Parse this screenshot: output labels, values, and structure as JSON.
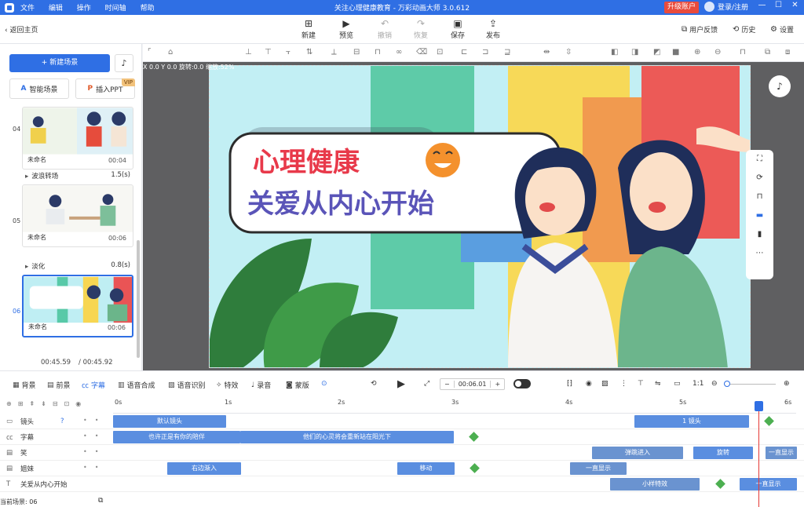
{
  "titlebar": {
    "menu": [
      "文件",
      "编辑",
      "操作",
      "时间轴",
      "帮助"
    ],
    "title": "关注心理健康教育 - 万彩动画大师 3.0.612",
    "upgrade": "升级账户",
    "login": "登录/注册"
  },
  "toolbar": {
    "back": "返回主页",
    "buttons": [
      {
        "label": "新建",
        "icon": "plus-square-icon"
      },
      {
        "label": "预览",
        "icon": "play-icon"
      },
      {
        "label": "撤销",
        "icon": "undo-icon"
      },
      {
        "label": "恢复",
        "icon": "redo-icon"
      },
      {
        "label": "保存",
        "icon": "save-icon"
      },
      {
        "label": "发布",
        "icon": "publish-icon"
      }
    ],
    "right": [
      "用户反馈",
      "历史",
      "设置"
    ]
  },
  "left_panel": {
    "new_scene": "+ 新建场景",
    "smart_scene": "智能场景",
    "insert_ppt": "插入PPT",
    "vip": "VIP",
    "scenes": [
      {
        "num": "04",
        "name": "未命名",
        "duration": "00:04"
      },
      {
        "num": "05",
        "name": "未命名",
        "duration": "00:06"
      },
      {
        "num": "06",
        "name": "未命名",
        "duration": "00:06"
      }
    ],
    "transitions": [
      {
        "name": "波浪转场",
        "duration": "1.5(s)"
      },
      {
        "name": "淡化",
        "duration": "0.8(s)"
      }
    ],
    "current_time": "00:45.59",
    "total_time": "/ 00:45.92"
  },
  "canvas": {
    "coords": "X 0.0  Y 0.0  旋转:0.0  缩放:52%",
    "headline1": "心理健康",
    "headline2": "关爱从内心开始"
  },
  "mainbar": {
    "items": [
      "背景",
      "前景",
      "字幕",
      "语音合成",
      "语音识别",
      "特效",
      "录音",
      "蒙版"
    ],
    "timecode": "00:06.01"
  },
  "timeline": {
    "ruler": [
      "0s",
      "1s",
      "2s",
      "3s",
      "4s",
      "5s",
      "6s"
    ],
    "rows": [
      {
        "label": "镜头",
        "clips": [
          "默认镜头",
          "1 镜头"
        ]
      },
      {
        "label": "字幕",
        "clips": [
          "也许正是有你的陪伴",
          "他们的心灵将会重新站在阳光下"
        ]
      },
      {
        "label": "笑",
        "clips": [
          "弹跳进入",
          "旋转",
          "一直显示"
        ]
      },
      {
        "label": "姐妹",
        "clips": [
          "右边渐入",
          "移动",
          "一直显示"
        ]
      },
      {
        "label": "关爱从内心开始",
        "clips": [
          "小样特效",
          "一直显示"
        ]
      }
    ]
  },
  "status": {
    "current_scene": "当前场景: 06"
  }
}
